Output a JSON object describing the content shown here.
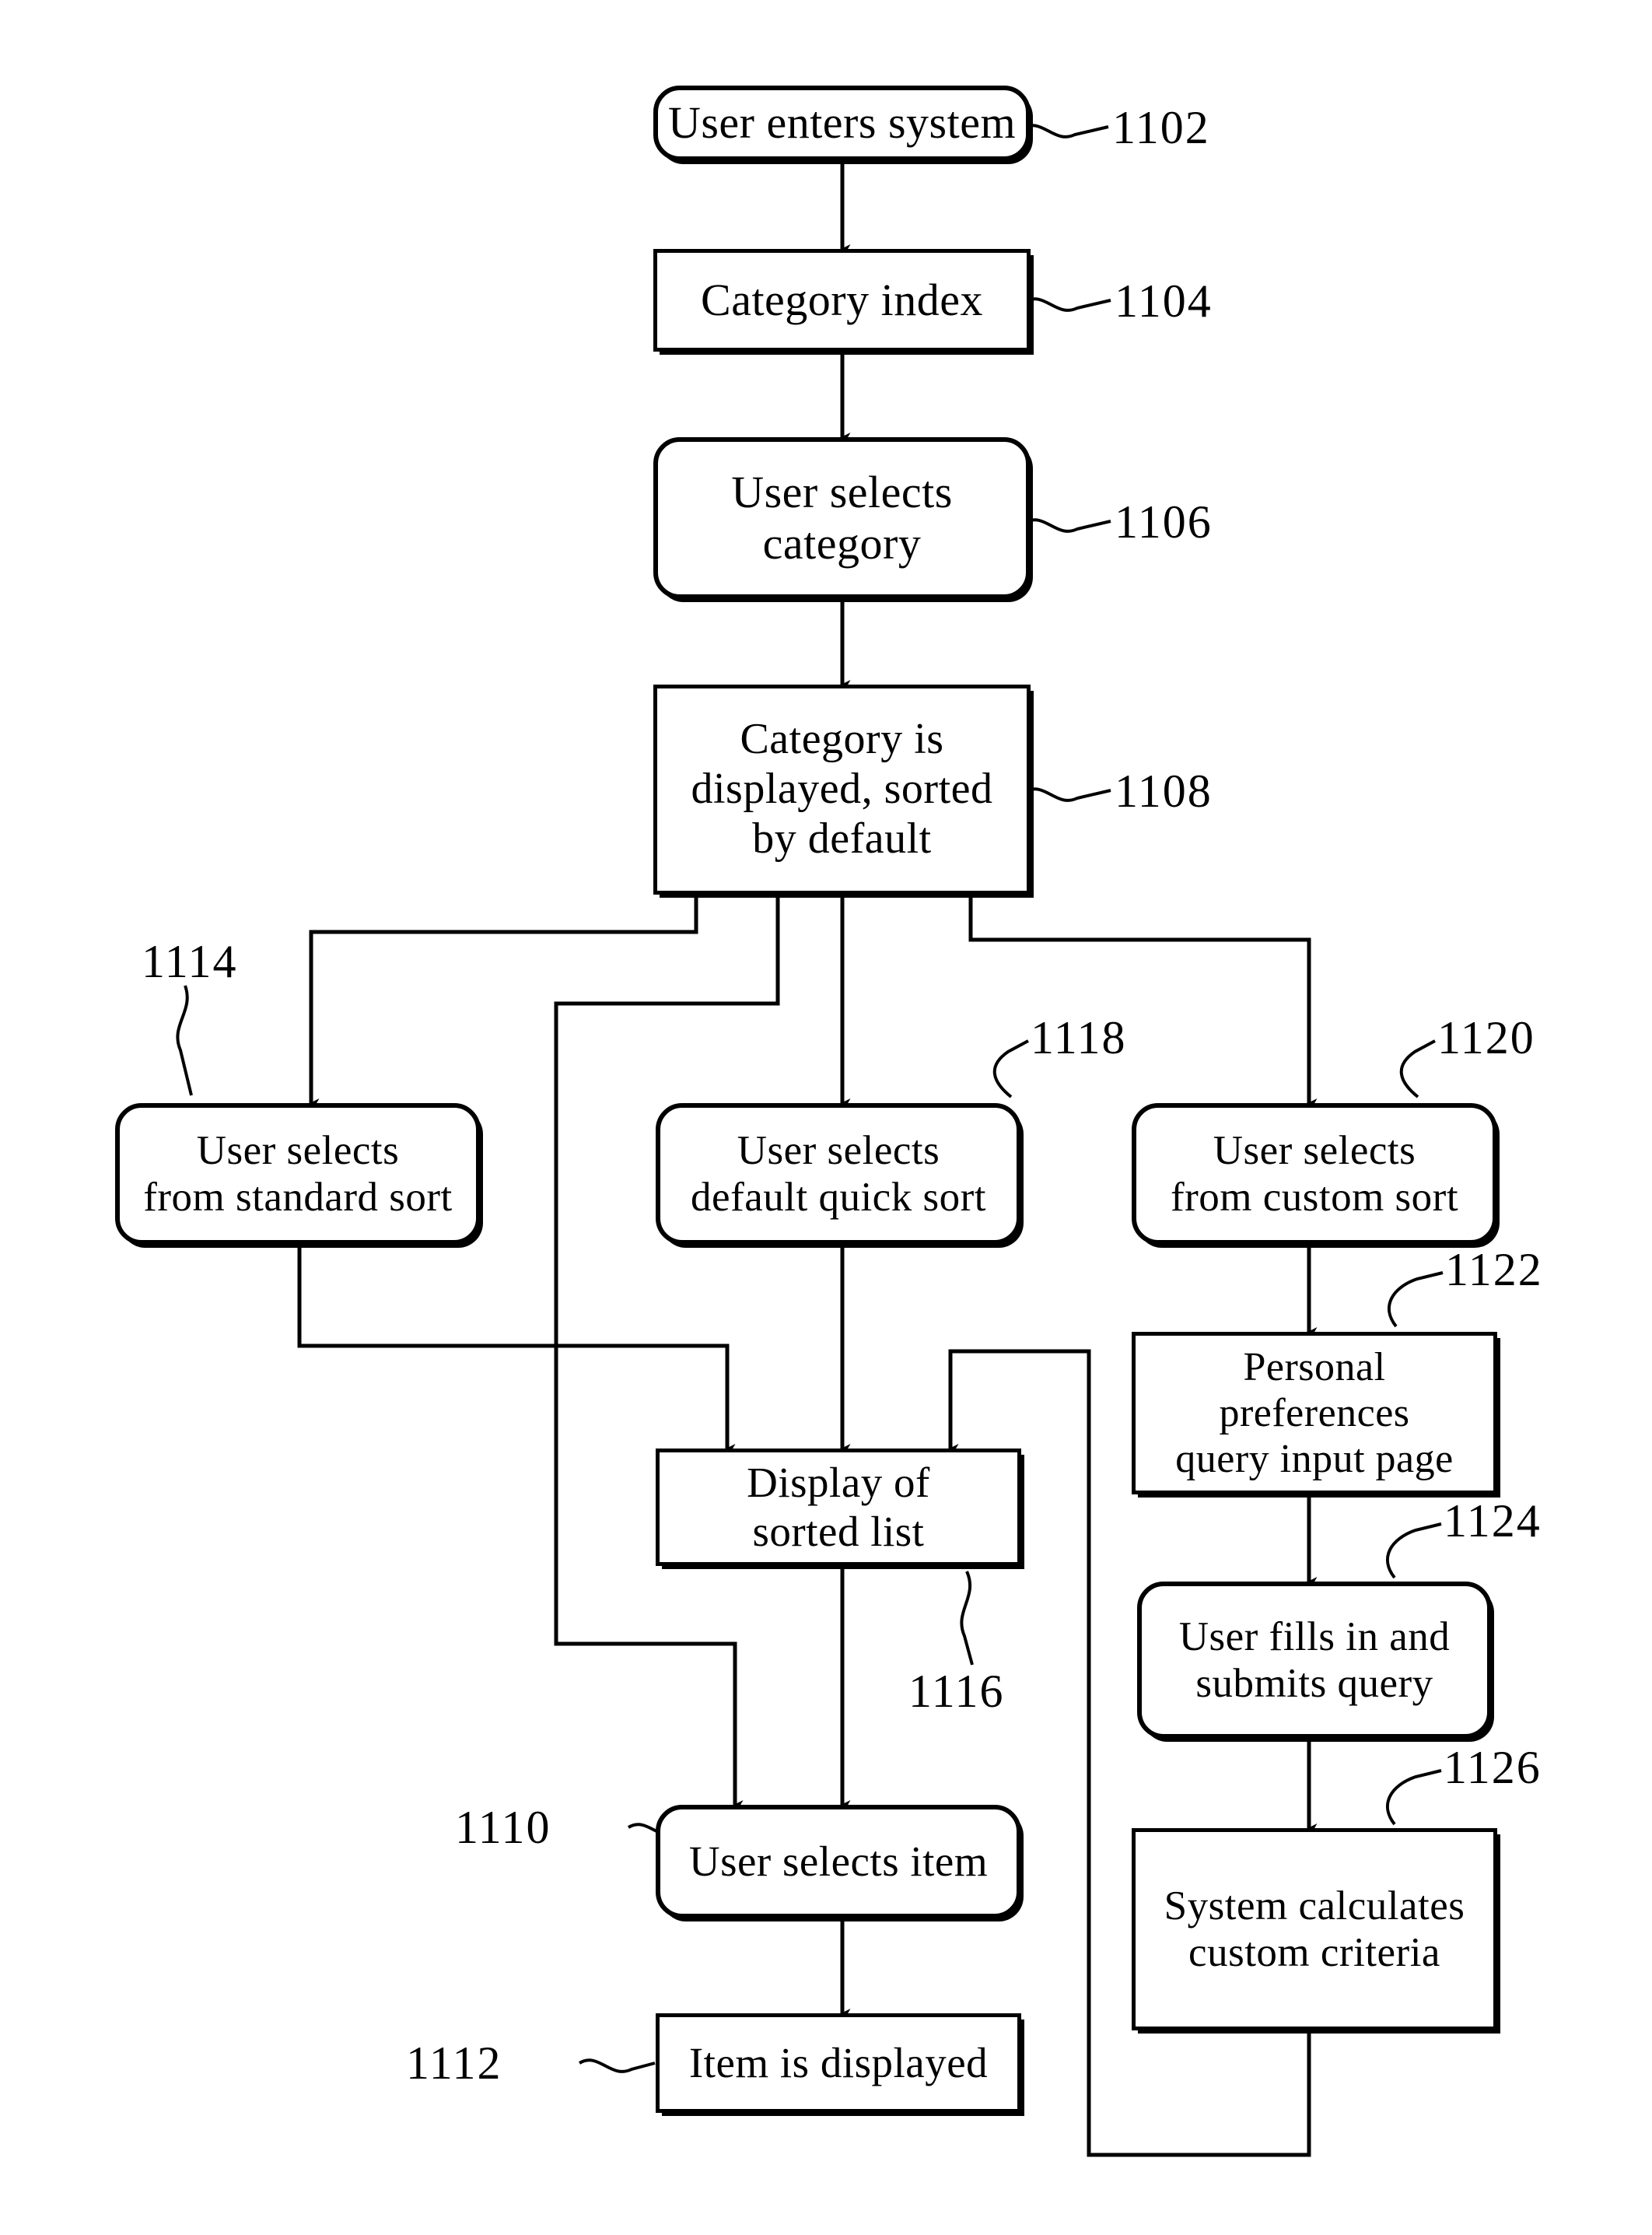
{
  "figure": {
    "type": "patent-flowchart",
    "nodes": [
      {
        "id": "1102",
        "label": "User enters system",
        "shape": "rounded",
        "ref": "1102"
      },
      {
        "id": "1104",
        "label": "Category index",
        "shape": "rect",
        "ref": "1104"
      },
      {
        "id": "1106",
        "label": "User selects\ncategory",
        "shape": "rounded",
        "ref": "1106"
      },
      {
        "id": "1108",
        "label": "Category is\ndisplayed, sorted\nby default",
        "shape": "rect",
        "ref": "1108"
      },
      {
        "id": "1114",
        "label": "User selects\nfrom standard sort",
        "shape": "rounded",
        "ref": "1114"
      },
      {
        "id": "1118",
        "label": "User selects\ndefault quick sort",
        "shape": "rounded",
        "ref": "1118"
      },
      {
        "id": "1120",
        "label": "User selects\nfrom custom sort",
        "shape": "rounded",
        "ref": "1120"
      },
      {
        "id": "1122",
        "label": "Personal\npreferences\nquery input page",
        "shape": "rect",
        "ref": "1122"
      },
      {
        "id": "1124",
        "label": "User fills in and\nsubmits query",
        "shape": "rounded",
        "ref": "1124"
      },
      {
        "id": "1126",
        "label": "System calculates\ncustom criteria",
        "shape": "rect",
        "ref": "1126"
      },
      {
        "id": "1116",
        "label": "Display of\nsorted list",
        "shape": "rect",
        "ref": "1116"
      },
      {
        "id": "1110",
        "label": "User selects item",
        "shape": "rounded",
        "ref": "1110"
      },
      {
        "id": "1112",
        "label": "Item is displayed",
        "shape": "rect",
        "ref": "1112"
      }
    ],
    "labels": {
      "n1102": "User enters system",
      "n1104": "Category index",
      "n1106_l1": "User selects",
      "n1106_l2": "category",
      "n1108_l1": "Category is",
      "n1108_l2": "displayed, sorted",
      "n1108_l3": "by default",
      "n1114_l1": "User selects",
      "n1114_l2": "from standard sort",
      "n1118_l1": "User selects",
      "n1118_l2": "default quick sort",
      "n1120_l1": "User selects",
      "n1120_l2": "from custom sort",
      "n1122_l1": "Personal",
      "n1122_l2": "preferences",
      "n1122_l3": "query input page",
      "n1124_l1": "User fills in and",
      "n1124_l2": "submits query",
      "n1126_l1": "System calculates",
      "n1126_l2": "custom criteria",
      "n1116_l1": "Display of",
      "n1116_l2": "sorted list",
      "n1110": "User selects item",
      "n1112": "Item is displayed"
    },
    "refs": {
      "r1102": "1102",
      "r1104": "1104",
      "r1106": "1106",
      "r1108": "1108",
      "r1110": "1110",
      "r1112": "1112",
      "r1114": "1114",
      "r1116": "1116",
      "r1118": "1118",
      "r1120": "1120",
      "r1122": "1122",
      "r1124": "1124",
      "r1126": "1126"
    },
    "edges": [
      {
        "from": "1102",
        "to": "1104"
      },
      {
        "from": "1104",
        "to": "1106"
      },
      {
        "from": "1106",
        "to": "1108"
      },
      {
        "from": "1108",
        "to": "1114"
      },
      {
        "from": "1108",
        "to": "1118"
      },
      {
        "from": "1108",
        "to": "1120"
      },
      {
        "from": "1108",
        "to": "1110"
      },
      {
        "from": "1114",
        "to": "1116"
      },
      {
        "from": "1118",
        "to": "1116"
      },
      {
        "from": "1120",
        "to": "1122"
      },
      {
        "from": "1122",
        "to": "1124"
      },
      {
        "from": "1124",
        "to": "1126"
      },
      {
        "from": "1126",
        "to": "1116"
      },
      {
        "from": "1116",
        "to": "1110"
      },
      {
        "from": "1110",
        "to": "1112"
      }
    ],
    "colors": {
      "ink": "#000000",
      "paper": "#ffffff"
    }
  }
}
